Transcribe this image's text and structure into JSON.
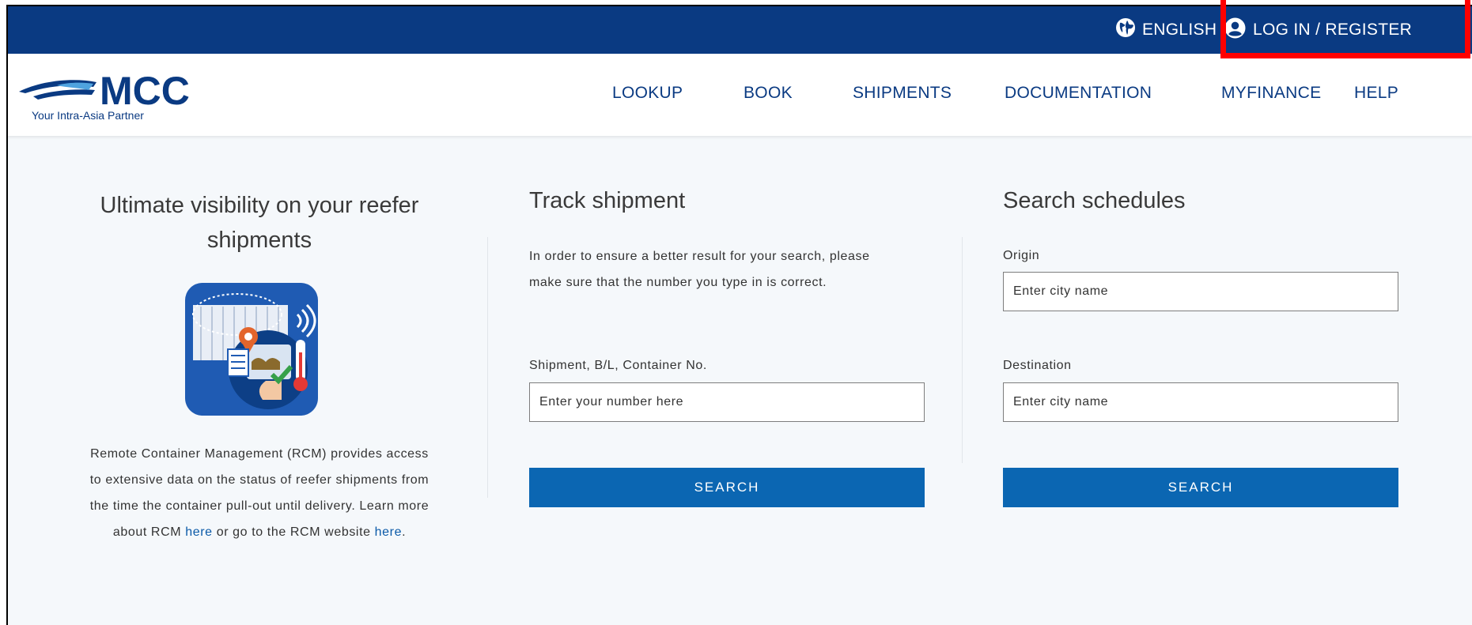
{
  "topbar": {
    "language_label": "ENGLISH",
    "login_label": "LOG IN / REGISTER"
  },
  "logo": {
    "brand": "MCC",
    "tagline": "Your Intra-Asia Partner"
  },
  "nav": {
    "items": [
      {
        "label": "LOOKUP"
      },
      {
        "label": "BOOK"
      },
      {
        "label": "SHIPMENTS"
      },
      {
        "label": "DOCUMENTATION"
      },
      {
        "label": "MYFINANCE"
      },
      {
        "label": "HELP"
      }
    ]
  },
  "reefer": {
    "title": "Ultimate visibility on your reefer shipments",
    "text_1": "Remote Container Management (RCM) provides access",
    "text_2": "to extensive data on the status of reefer shipments from",
    "text_3": "the time the container pull-out until delivery. Learn more",
    "text_4_prefix": "about RCM ",
    "link_1": "here",
    "text_4_mid": " or go to the RCM website ",
    "link_2": "here",
    "text_4_suffix": "."
  },
  "track": {
    "title": "Track shipment",
    "description_1": "In order to ensure a better result for your search, please",
    "description_2": "make sure that the number you type in is correct.",
    "field_label": "Shipment, B/L, Container No.",
    "placeholder": "Enter your number here",
    "button_label": "SEARCH"
  },
  "schedules": {
    "title": "Search schedules",
    "origin_label": "Origin",
    "origin_placeholder": "Enter city name",
    "destination_label": "Destination",
    "destination_placeholder": "Enter city name",
    "button_label": "SEARCH"
  },
  "colors": {
    "topbar": "#0a3a82",
    "accent_button": "#0b66b2",
    "highlight": "#ff0000"
  }
}
